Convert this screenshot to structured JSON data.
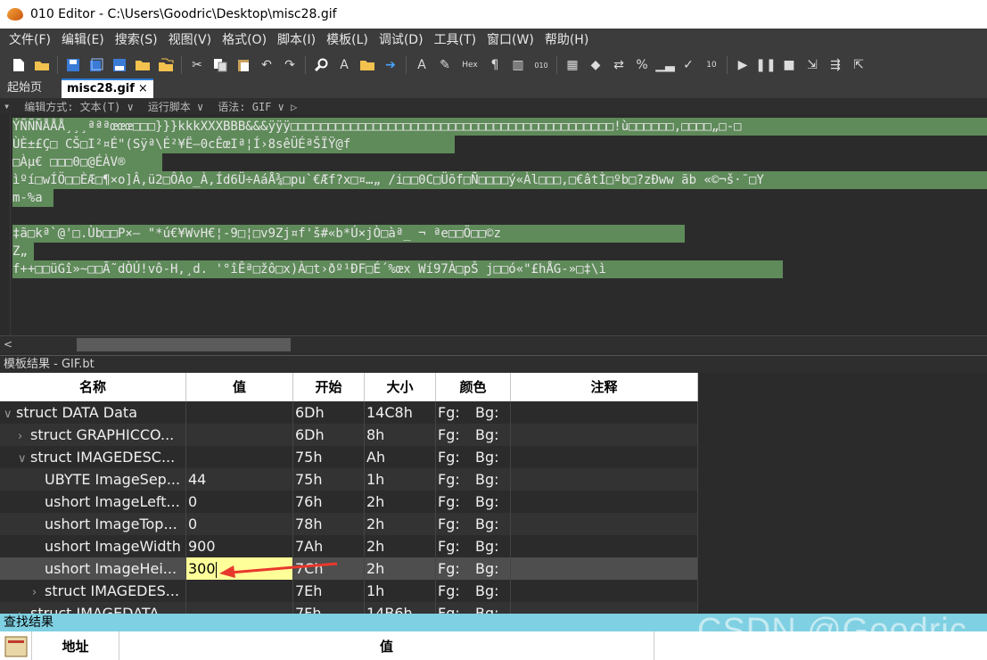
{
  "window": {
    "title": "010 Editor - C:\\Users\\Goodric\\Desktop\\misc28.gif"
  },
  "menu": [
    "文件(F)",
    "编辑(E)",
    "搜索(S)",
    "视图(V)",
    "格式(O)",
    "脚本(I)",
    "模板(L)",
    "调试(D)",
    "工具(T)",
    "窗口(W)",
    "帮助(H)"
  ],
  "toolbar": {
    "icons": [
      "new-file-icon",
      "open-folder-icon",
      "save-icon",
      "save-all-icon",
      "save-as-icon",
      "folder-icon",
      "folders-icon",
      "cut-icon",
      "copy-icon",
      "paste-icon",
      "undo-icon",
      "redo-icon",
      "find-icon",
      "replace-icon",
      "find-in-files-icon",
      "goto-icon",
      "font-icon",
      "highlight-icon",
      "hex-icon",
      "paragraph-icon",
      "columns-icon",
      "binary-icon",
      "calculator-icon",
      "bookmark-icon",
      "compare-icon",
      "percent-icon",
      "histogram-icon",
      "checksum-icon",
      "base-convert-icon",
      "run-icon",
      "pause-icon",
      "stop-icon",
      "step-into-icon",
      "step-over-icon",
      "step-out-icon"
    ],
    "hex_label": "Hex"
  },
  "tabs": {
    "home": "起始页",
    "active": "misc28.gif",
    "close": "×"
  },
  "infobar": {
    "edit_mode": "编辑方式: 文本(T) ∨",
    "run_script": "运行脚本 ∨",
    "syntax": "语法: GIF ∨ ▷"
  },
  "text_lines": [
    "ÝÑÑÑÅÅÅ¸¸¸ªªªœœœ□□□}}}kkkXXXBBB&&&ÿÿÿ□□□□□□□□□□□□□□□□□□□□□□□□□□□□□□□□□□□□□□□□□□□!ù□□□□□□,□□□□„□-□",
    "ÙÈ±£Ç□ CŠ□I²¤É\"(Sÿª\\É²¥Ë–0cÊœIª¦Í›8sêÜÉªŠÏŸ@f",
    "□Àµ€ □□□0□@ÉÀV®",
    "ìºí□wÍÖ□□ÈÆ□¶×o]Â,ü2□ÔÀo_À,Íd6Ü÷AáÅ¾□pu`€Æf?x□¤…„ /i□□0C□Üõf□Ñ□□□□ý«Àl□□□,□€âtÌ□ºb□?zÐww  ãb «©¬š·¯□Y",
    "m-%a",
    "",
    "‡ã□kª`@'□.Ùb□□P×—    \"*ú€¥WvH€¦-9□¦□v9Zj¤f'š#«b*Ú×jÒ□àª_ ¬ ªe□□Ö□□©z",
    "Z„",
    "f++□□üGî»~□□Ã˜dÒÚ!vô-H,¸d. '°îÊª□žô□x)À□t›ðº¹ÐF□É´%œx Wí97À□pŠ j□□ó«\"£hÅG-»□‡\\ì"
  ],
  "template": {
    "title": "模板结果 - GIF.bt",
    "columns": [
      "名称",
      "值",
      "开始",
      "大小",
      "颜色",
      "注释"
    ],
    "rows": [
      {
        "name": "struct DATA Data",
        "value": "",
        "start": "6Dh",
        "size": "14C8h",
        "fg": "Fg:",
        "bg": "Bg:",
        "expander": "∨"
      },
      {
        "name": "struct GRAPHICCO...",
        "value": "",
        "start": "6Dh",
        "size": "8h",
        "fg": "Fg:",
        "bg": "Bg:",
        "expander": "›"
      },
      {
        "name": "struct IMAGEDESC...",
        "value": "",
        "start": "75h",
        "size": "Ah",
        "fg": "Fg:",
        "bg": "Bg:",
        "expander": "∨"
      },
      {
        "name": "UBYTE ImageSep...",
        "value": "44",
        "start": "75h",
        "size": "1h",
        "fg": "Fg:",
        "bg": "Bg:",
        "expander": ""
      },
      {
        "name": "ushort ImageLeft...",
        "value": "0",
        "start": "76h",
        "size": "2h",
        "fg": "Fg:",
        "bg": "Bg:",
        "expander": ""
      },
      {
        "name": "ushort ImageTop...",
        "value": "0",
        "start": "78h",
        "size": "2h",
        "fg": "Fg:",
        "bg": "Bg:",
        "expander": ""
      },
      {
        "name": "ushort ImageWidth",
        "value": "900",
        "start": "7Ah",
        "size": "2h",
        "fg": "Fg:",
        "bg": "Bg:",
        "expander": ""
      },
      {
        "name": "ushort ImageHei...",
        "value": "300",
        "start": "7Ch",
        "size": "2h",
        "fg": "Fg:",
        "bg": "Bg:",
        "expander": ""
      },
      {
        "name": "struct IMAGEDES...",
        "value": "",
        "start": "7Eh",
        "size": "1h",
        "fg": "Fg:",
        "bg": "Bg:",
        "expander": "›"
      },
      {
        "name": "struct IMAGEDATA",
        "value": "",
        "start": "7Fh",
        "size": "14B6h",
        "fg": "Fg:",
        "bg": "Bg:",
        "expander": "›"
      }
    ]
  },
  "find": {
    "title": "查找结果",
    "columns": [
      "地址",
      "值"
    ]
  },
  "watermark": "CSDN @Goodric",
  "colors": {
    "accent": "#2d7bd3",
    "highlight_green": "#5f8a5a",
    "edit_yellow": "#ffff99",
    "annotation_arrow": "#e8382c"
  }
}
